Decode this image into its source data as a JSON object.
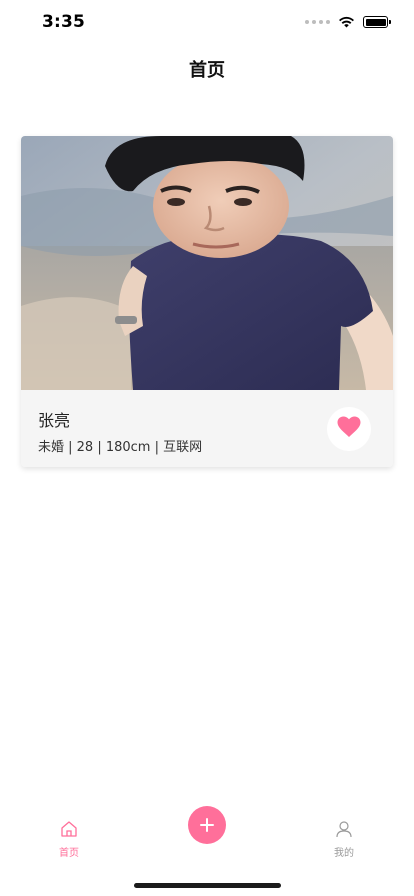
{
  "status_bar": {
    "time": "3:35"
  },
  "nav": {
    "title": "首页"
  },
  "card": {
    "name": "张亮",
    "meta": "未婚 | 28 | 180cm | 互联网"
  },
  "tabs": [
    {
      "label": "首页",
      "icon": "home-icon",
      "active": true
    },
    {
      "label": "我的",
      "icon": "user-icon",
      "active": false
    }
  ],
  "add_button": {
    "icon": "plus-icon"
  },
  "colors": {
    "accent": "#ff6f9a",
    "inactive": "#9a9a9a",
    "card_bg": "#f5f5f5"
  }
}
